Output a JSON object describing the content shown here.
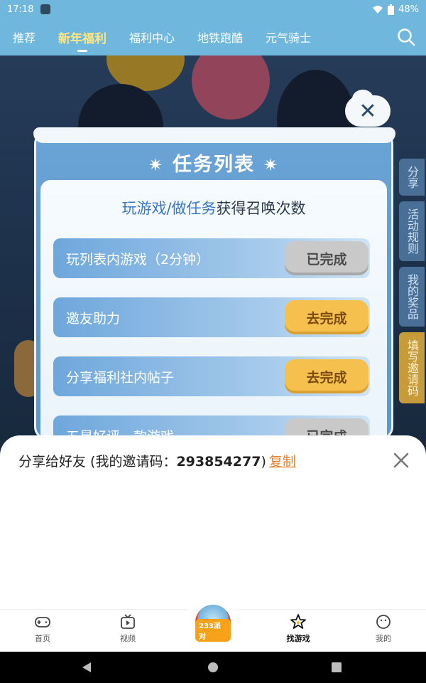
{
  "status_bar": {
    "time": "17:18",
    "battery": "48%"
  },
  "top_nav": {
    "tabs": [
      {
        "label": "推荐",
        "active": false
      },
      {
        "label": "新年福利",
        "active": true
      },
      {
        "label": "福利中心",
        "active": false
      },
      {
        "label": "地铁跑酷",
        "active": false
      },
      {
        "label": "元气骑士",
        "active": false
      }
    ],
    "search_icon": "search-icon"
  },
  "side_tabs": [
    "分享",
    "活动规则",
    "我的奖品",
    "填写邀请码"
  ],
  "modal": {
    "title": "任务列表",
    "subtitle_highlight": "玩游戏/做任务",
    "subtitle_rest": "获得召唤次数",
    "tasks": [
      {
        "label": "玩列表内游戏（2分钟）",
        "button": "已完成",
        "state": "done"
      },
      {
        "label": "邀友助力",
        "button": "去完成",
        "state": "todo"
      },
      {
        "label": "分享福利社内帖子",
        "button": "去完成",
        "state": "todo"
      },
      {
        "label": "五星好评一款游戏",
        "button": "已完成",
        "state": "done"
      }
    ]
  },
  "share_sheet": {
    "title_prefix": "分享给好友 (我的邀请码：",
    "invite_code": "293854277",
    "title_suffix": ")",
    "copy_label": "复制"
  },
  "bottom_nav": {
    "items": [
      {
        "label": "首页",
        "icon": "gamepad-icon"
      },
      {
        "label": "视频",
        "icon": "tv-icon"
      },
      {
        "label": "找游戏",
        "icon": "star-icon",
        "active": true
      },
      {
        "label": "我的",
        "icon": "smile-icon"
      }
    ],
    "center_badge": "233派对"
  },
  "colors": {
    "header": "#6fb7dc",
    "active_tab": "#ffe680",
    "copy_link": "#e8802a",
    "button_todo": "#f6c04f",
    "button_done": "#c9c9c9"
  }
}
